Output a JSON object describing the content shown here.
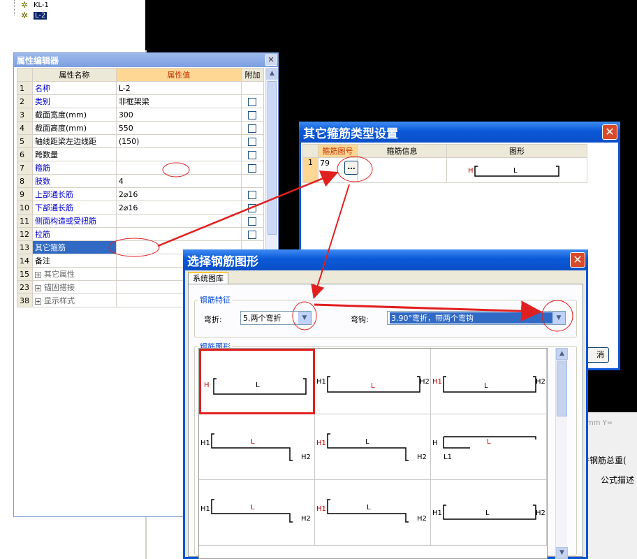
{
  "tree": {
    "items": [
      {
        "label": "KL-1",
        "selected": false
      },
      {
        "label": "L-2",
        "selected": true
      }
    ]
  },
  "property_editor": {
    "title": "属性编辑器",
    "close_icon": "close-icon",
    "headers": {
      "num": "",
      "name": "属性名称",
      "value": "属性值",
      "extra": "附加"
    },
    "rows": [
      {
        "num": "1",
        "name": "名称",
        "value": "L-2",
        "checkbox": false,
        "name_color": "blue",
        "expand": false
      },
      {
        "num": "2",
        "name": "类别",
        "value": "非框架梁",
        "checkbox": true,
        "name_color": "blue",
        "expand": false
      },
      {
        "num": "3",
        "name": "截面宽度(mm)",
        "value": "300",
        "checkbox": true,
        "name_color": "black",
        "expand": false
      },
      {
        "num": "4",
        "name": "截面高度(mm)",
        "value": "550",
        "checkbox": true,
        "name_color": "black",
        "expand": false
      },
      {
        "num": "5",
        "name": "轴线距梁左边线距",
        "value": "(150)",
        "checkbox": true,
        "name_color": "black",
        "expand": false
      },
      {
        "num": "6",
        "name": "跨数量",
        "value": "",
        "checkbox": true,
        "name_color": "black",
        "expand": false
      },
      {
        "num": "7",
        "name": "箍筋",
        "value": "",
        "checkbox": true,
        "name_color": "blue",
        "expand": false
      },
      {
        "num": "8",
        "name": "肢数",
        "value": "4",
        "checkbox": false,
        "name_color": "blue",
        "expand": false
      },
      {
        "num": "9",
        "name": "上部通长筋",
        "value": "2⌀16",
        "checkbox": true,
        "name_color": "blue",
        "expand": false
      },
      {
        "num": "10",
        "name": "下部通长筋",
        "value": "2⌀16",
        "checkbox": true,
        "name_color": "blue",
        "expand": false
      },
      {
        "num": "11",
        "name": "侧面构造或受扭筋",
        "value": "",
        "checkbox": true,
        "name_color": "blue",
        "expand": false
      },
      {
        "num": "12",
        "name": "拉筋",
        "value": "",
        "checkbox": true,
        "name_color": "blue",
        "expand": false
      },
      {
        "num": "13",
        "name": "其它箍筋",
        "value": "",
        "checkbox": false,
        "name_color": "selected",
        "expand": false
      },
      {
        "num": "14",
        "name": "备注",
        "value": "",
        "checkbox": false,
        "name_color": "black",
        "expand": false
      },
      {
        "num": "15",
        "name": "其它属性",
        "value": "",
        "checkbox": false,
        "name_color": "gray",
        "expand": true
      },
      {
        "num": "23",
        "name": "锚固搭接",
        "value": "",
        "checkbox": false,
        "name_color": "gray",
        "expand": true
      },
      {
        "num": "38",
        "name": "显示样式",
        "value": "",
        "checkbox": false,
        "name_color": "gray",
        "expand": true
      }
    ]
  },
  "stirrup_dialog": {
    "title": "其它箍筋类型设置",
    "headers": {
      "num": "",
      "shape_no": "箍筋图号",
      "info": "箍筋信息",
      "figure": "图形"
    },
    "row": {
      "num": "1",
      "shape_no": "79",
      "button": "…",
      "info": "",
      "figure_h": "H",
      "figure_l": "L"
    },
    "cancel_label": "消"
  },
  "shape_dialog": {
    "title": "选择钢筋图形",
    "tab": "系统图库",
    "feature_group": "钢筋特征",
    "bend_label": "弯折:",
    "bend_value": "5.两个弯折",
    "hook_label": "弯钩:",
    "hook_value": "3.90°弯折，带两个弯钩",
    "shapes_group": "钢筋图形",
    "shapes": [
      {
        "labels": [
          "H",
          "L"
        ]
      },
      {
        "labels": [
          "H1",
          "L",
          "H2"
        ]
      },
      {
        "labels": [
          "H1",
          "L",
          "H2"
        ]
      },
      {
        "labels": [
          "H1",
          "L",
          "H2"
        ]
      },
      {
        "labels": [
          "H1",
          "L",
          "H2"
        ]
      },
      {
        "labels": [
          "H",
          "L",
          "L1"
        ]
      },
      {
        "labels": [
          "H1",
          "L",
          "H2"
        ]
      },
      {
        "labels": [
          "H1",
          "L",
          "H2"
        ]
      },
      {
        "labels": [
          "H1",
          "L",
          "H2"
        ]
      }
    ]
  },
  "background": {
    "coord_unit": "mm",
    "coord_y": "Y=",
    "total_label": "件钢筋总重(",
    "formula_label": "公式描述"
  },
  "colors": {
    "accent_red": "#e02020",
    "title_blue": "#0a53d8"
  }
}
